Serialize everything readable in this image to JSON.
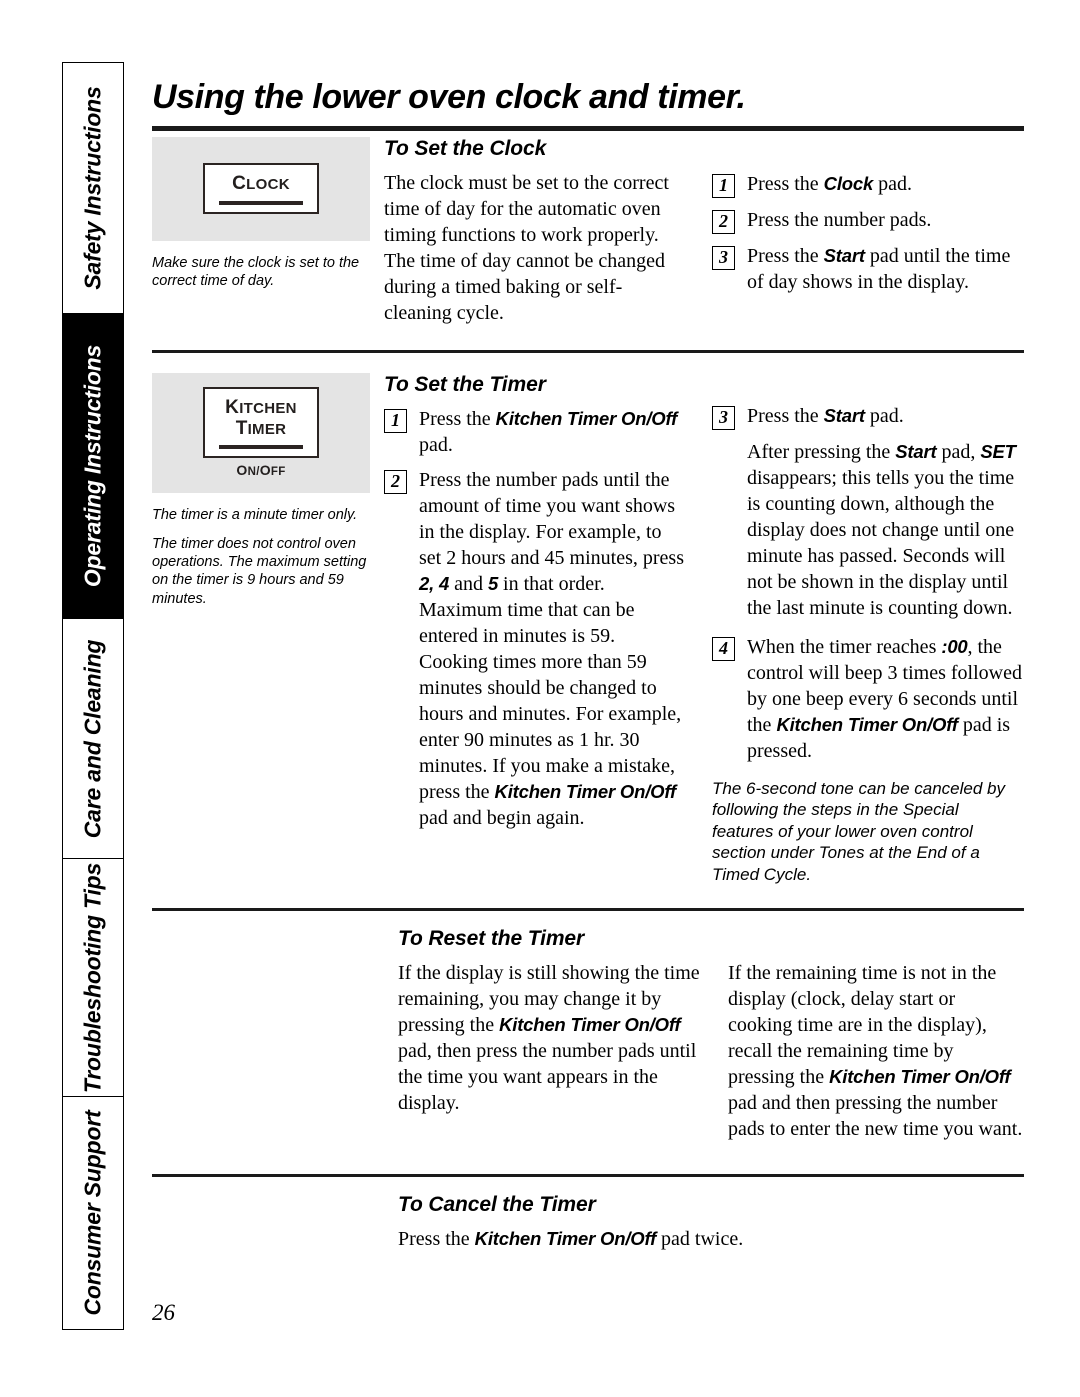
{
  "page": {
    "title": "Using the lower oven clock and timer.",
    "number": "26"
  },
  "sidebar": {
    "items": [
      {
        "label": "Safety Instructions",
        "active": false
      },
      {
        "label": "Operating Instructions",
        "active": true
      },
      {
        "label": "Care and Cleaning",
        "active": false
      },
      {
        "label": "Troubleshooting Tips",
        "active": false
      },
      {
        "label": "Consumer Support",
        "active": false
      }
    ]
  },
  "sections": {
    "set_clock": {
      "heading": "To Set the Clock",
      "illustration": {
        "pad_label": "CLOCK",
        "pad_label_lead": "C",
        "pad_label_rest": "LOCK"
      },
      "notes": [
        "Make sure the clock is set to the correct time of day."
      ],
      "body": "The clock must be set to the correct time of day for the automatic oven timing functions to work properly. The time of day cannot be changed during a timed baking or self-cleaning cycle.",
      "steps": [
        {
          "num": "1",
          "pre": "Press the ",
          "strong": "Clock",
          "post": " pad."
        },
        {
          "num": "2",
          "pre": "Press the number pads.",
          "strong": "",
          "post": ""
        },
        {
          "num": "3",
          "pre": "Press the ",
          "strong": "Start",
          "post": " pad until the time of day shows in the display."
        }
      ]
    },
    "set_timer": {
      "heading": "To Set the Timer",
      "illustration": {
        "pad_line1_lead": "K",
        "pad_line1_rest": "ITCHEN",
        "pad_line2_lead": "T",
        "pad_line2_rest": "IMER",
        "pad_sub_lead1": "O",
        "pad_sub_rest1": "N/",
        "pad_sub_lead2": "O",
        "pad_sub_rest2": "FF"
      },
      "notes": [
        "The timer is a minute timer only.",
        "The timer does not control oven operations. The maximum setting on the timer is 9 hours and 59 minutes."
      ],
      "step1_pre": "Press the ",
      "step1_strong": "Kitchen Timer On/Off",
      "step1_post": " pad.",
      "step2_a": "Press the number pads until the amount of time you want shows in the display. For example, to set 2 hours and 45 minutes, press ",
      "step2_b": "2, 4",
      "step2_c": " and ",
      "step2_d": "5",
      "step2_e": " in that order. Maximum time that can be entered in minutes is 59. Cooking times more than 59 minutes should be changed to hours and minutes. For example, enter 90 minutes as 1 hr. 30 minutes. If you make a mistake, press the ",
      "step2_f": "Kitchen Timer On/Off",
      "step2_g": " pad and begin again.",
      "step3_pre": "Press the ",
      "step3_strong": "Start",
      "step3_post": " pad.",
      "step3_cont_a": "After pressing the ",
      "step3_cont_b": "Start",
      "step3_cont_c": " pad, ",
      "step3_cont_d": "SET",
      "step3_cont_e": " disappears; this tells you the time is counting down, although the display does not change until one minute has passed. Seconds will not be shown in the display until the last minute is counting down.",
      "step4_a": "When the timer reaches ",
      "step4_b": ":00",
      "step4_c": ", the control will beep 3 times followed by one beep every 6 seconds until the ",
      "step4_d": "Kitchen Timer On/Off",
      "step4_e": " pad is pressed.",
      "footnote": "The 6-second tone can be canceled by following the steps in the Special features of your lower oven control section under Tones at the End of a Timed Cycle."
    },
    "reset_timer": {
      "heading": "To Reset the Timer",
      "left_a": "If the display is still showing the time remaining, you may change it by pressing the ",
      "left_b": "Kitchen Timer On/Off",
      "left_c": " pad, then press the number pads until the time you want appears in the display.",
      "right_a": "If the remaining time is not in the display (clock, delay start or cooking time are in the display), recall the remaining time by pressing the ",
      "right_b": "Kitchen Timer On/Off",
      "right_c": " pad and then pressing the number pads to enter the new time you want."
    },
    "cancel_timer": {
      "heading": "To Cancel the Timer",
      "body_a": "Press the ",
      "body_b": "Kitchen Timer On/Off",
      "body_c": " pad twice."
    }
  }
}
